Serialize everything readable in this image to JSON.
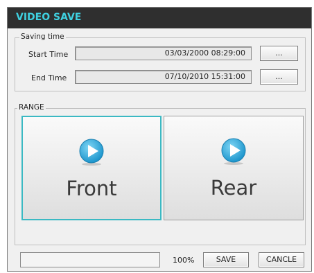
{
  "window": {
    "title": "VIDEO SAVE"
  },
  "saving_time": {
    "legend": "Saving time",
    "start_label": "Start Time",
    "start_value": "03/03/2000 08:29:00",
    "end_label": "End Time",
    "end_value": "07/10/2010 15:31:00",
    "browse_label": "..."
  },
  "range": {
    "legend": "RANGE",
    "front_label": "Front",
    "rear_label": "Rear",
    "selected": "Front",
    "icon": "play-circle-icon"
  },
  "footer": {
    "progress_value": 1.0,
    "progress_text": "100%",
    "save_label": "SAVE",
    "cancel_label": "CANCLE"
  },
  "colors": {
    "title": "#3fd0e0",
    "titlebar": "#2f2f2f",
    "selection_border": "#3bb9c3",
    "play_icon": "#1fa3d6"
  }
}
